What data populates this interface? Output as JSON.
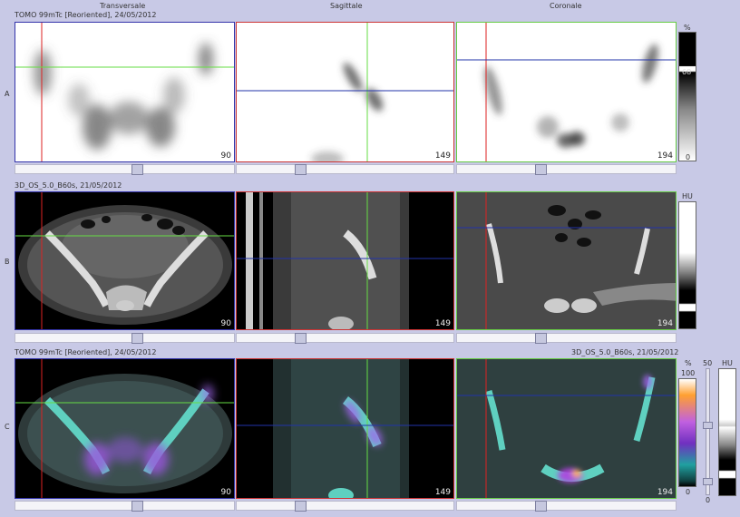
{
  "headers": {
    "transversale": "Transversale",
    "sagittale": "Sagittale",
    "coronale": "Coronale"
  },
  "rows": {
    "a": {
      "letter": "A",
      "title": "TOMO 99mTc [Reoriented], 24/05/2012",
      "slices": [
        "90",
        "149",
        "194"
      ],
      "scale_unit": "%",
      "scale_mid": "68",
      "scale_min": "0"
    },
    "b": {
      "letter": "B",
      "title": "3D_OS_5.0_B60s, 21/05/2012",
      "slices": [
        "90",
        "149",
        "194"
      ],
      "scale_unit": "HU"
    },
    "c": {
      "letter": "C",
      "title_left": "TOMO 99mTc [Reoriented], 24/05/2012",
      "title_right": "3D_OS_5.0_B60s, 21/05/2012",
      "slices": [
        "90",
        "149",
        "194"
      ],
      "scale_unit_pct": "%",
      "scale_max": "100",
      "scale_min": "0",
      "vslider_max": "50",
      "vslider_min": "0",
      "scale_unit_hu": "HU"
    }
  },
  "colors": {
    "background": "#c8c9e6",
    "transversal_frame": "#3333aa",
    "sagittal_frame": "#cc3333",
    "coronal_frame": "#66cc44",
    "crosshair_red": "#dd2222",
    "crosshair_green": "#66dd44",
    "crosshair_blue": "#2233aa"
  }
}
